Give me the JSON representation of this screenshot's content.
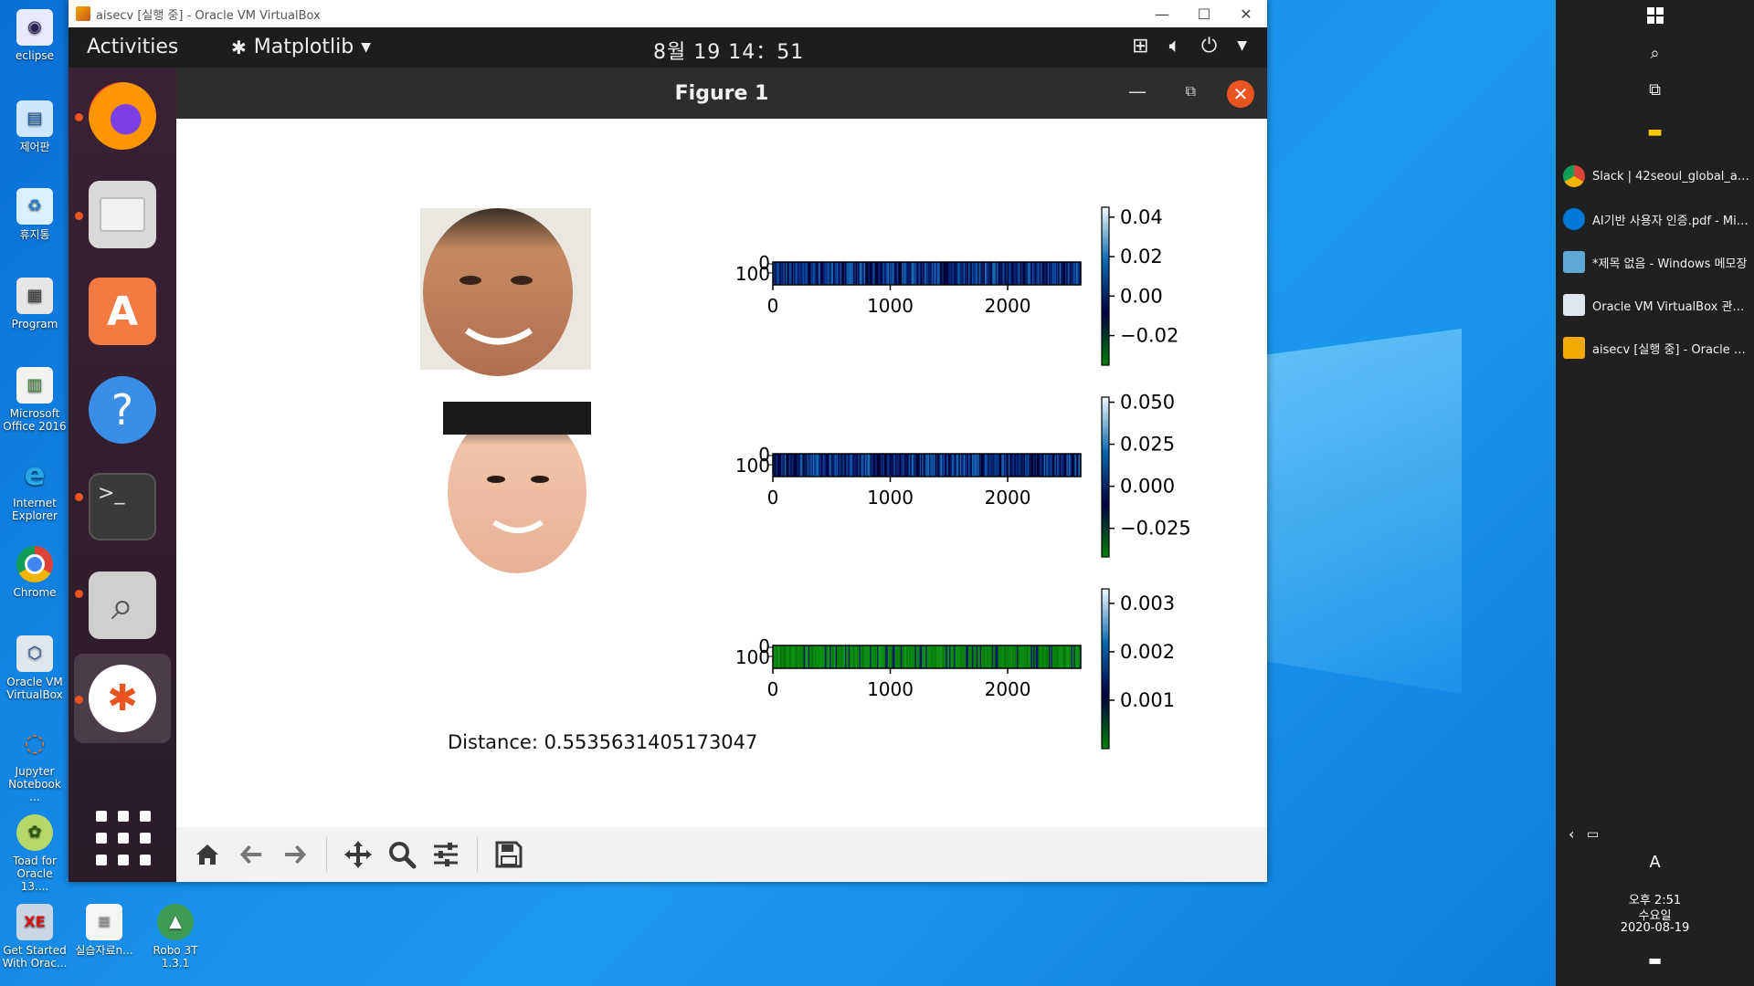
{
  "desktop": {
    "icons": [
      {
        "label": "eclipse"
      },
      {
        "label": "제어판"
      },
      {
        "label": "휴지통"
      },
      {
        "label": "Program"
      },
      {
        "label": "Microsoft Office 2016"
      },
      {
        "label": "Internet Explorer"
      },
      {
        "label": "Chrome"
      },
      {
        "label": "Oracle VM VirtualBox"
      },
      {
        "label": "Jupyter Notebook ..."
      },
      {
        "label": "Toad for Oracle 13...."
      },
      {
        "label": "Get Started With Orac..."
      },
      {
        "label": "실습자료n..."
      },
      {
        "label": "Robo 3T 1.3.1"
      }
    ]
  },
  "vm_window": {
    "title": "aisecv [실행 중] - Oracle VM VirtualBox",
    "controls": {
      "minimize": "—",
      "maximize": "☐",
      "close": "✕"
    }
  },
  "gnome": {
    "activities": "Activities",
    "app_menu": "Matplotlib",
    "clock": "8월 19  14：51"
  },
  "figure": {
    "title": "Figure 1",
    "distance_text": "Distance: 0.5535631405173047"
  },
  "chart_data": [
    {
      "type": "heatmap",
      "title": "",
      "x_ticks": [
        "0",
        "1000",
        "2000"
      ],
      "y_ticks": [
        "0",
        "100"
      ],
      "xlim": [
        0,
        2622
      ],
      "colorbar_ticks": [
        "0.04",
        "0.02",
        "0.00",
        "−0.02"
      ],
      "colorbar_range": [
        -0.035,
        0.045
      ],
      "colormap": "ocean"
    },
    {
      "type": "heatmap",
      "title": "",
      "x_ticks": [
        "0",
        "1000",
        "2000"
      ],
      "y_ticks": [
        "0",
        "100"
      ],
      "xlim": [
        0,
        2622
      ],
      "colorbar_ticks": [
        "0.050",
        "0.025",
        "0.000",
        "−0.025"
      ],
      "colorbar_range": [
        -0.042,
        0.053
      ],
      "colormap": "ocean"
    },
    {
      "type": "heatmap",
      "title": "",
      "x_ticks": [
        "0",
        "1000",
        "2000"
      ],
      "y_ticks": [
        "0",
        "100"
      ],
      "xlim": [
        0,
        2622
      ],
      "colorbar_ticks": [
        "0.003",
        "0.002",
        "0.001"
      ],
      "colorbar_range": [
        0.0,
        0.0033
      ],
      "colormap": "ocean"
    }
  ],
  "taskbar": {
    "windows": [
      {
        "label": "Slack | 42seoul_global_annou...",
        "color": "#4285f4"
      },
      {
        "label": "AI기반 사용자 인증.pdf - Mic...",
        "color": "#0078d7"
      },
      {
        "label": "*제목 없음 - Windows 메모장",
        "color": "#5fa8d3"
      },
      {
        "label": "Oracle VM VirtualBox 관리자",
        "color": "#dfe6ee"
      },
      {
        "label": "aisecv [실행 중] - Oracle VM ...",
        "color": "#f2a900"
      }
    ],
    "ime": "A",
    "time": "오후 2:51",
    "weekday": "수요일",
    "date": "2020-08-19"
  },
  "colors": {
    "ubuntu_orange": "#e95420",
    "taskbar": "#202020",
    "desktop": "#1d9bf0"
  }
}
